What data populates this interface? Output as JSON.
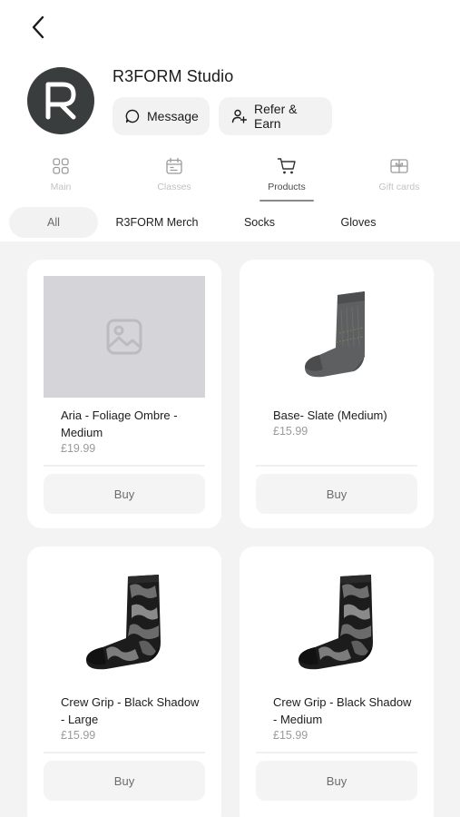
{
  "header": {
    "back_icon": "chevron-left-icon",
    "studio_name": "R3FORM Studio",
    "avatar_letter": "R",
    "message_label": "Message",
    "refer_label": "Refer & Earn"
  },
  "tabs": [
    {
      "label": "Main",
      "icon": "grid-icon",
      "active": false
    },
    {
      "label": "Classes",
      "icon": "calendar-icon",
      "active": false
    },
    {
      "label": "Products",
      "icon": "cart-icon",
      "active": true
    },
    {
      "label": "Gift cards",
      "icon": "gift-icon",
      "active": false
    }
  ],
  "filters": [
    {
      "label": "All",
      "active": true
    },
    {
      "label": "R3FORM Merch",
      "active": false
    },
    {
      "label": "Socks",
      "active": false
    },
    {
      "label": "Gloves",
      "active": false
    }
  ],
  "products": [
    {
      "name": "Aria - Foliage Ombre - Medium",
      "price": "£19.99",
      "buy_label": "Buy",
      "image": "placeholder-image-icon"
    },
    {
      "name": "Base- Slate (Medium)",
      "price": "£15.99",
      "buy_label": "Buy",
      "image": "grey-sock"
    },
    {
      "name": "Crew Grip - Black Shadow - Large",
      "price": "£15.99",
      "buy_label": "Buy",
      "image": "camo-sock"
    },
    {
      "name": "Crew Grip - Black Shadow - Medium",
      "price": "£15.99",
      "buy_label": "Buy",
      "image": "camo-sock"
    }
  ],
  "colors": {
    "avatar_bg": "#3a3d3d",
    "grid_bg": "#f3f3f3",
    "placeholder_bg": "#d5d5d9"
  }
}
